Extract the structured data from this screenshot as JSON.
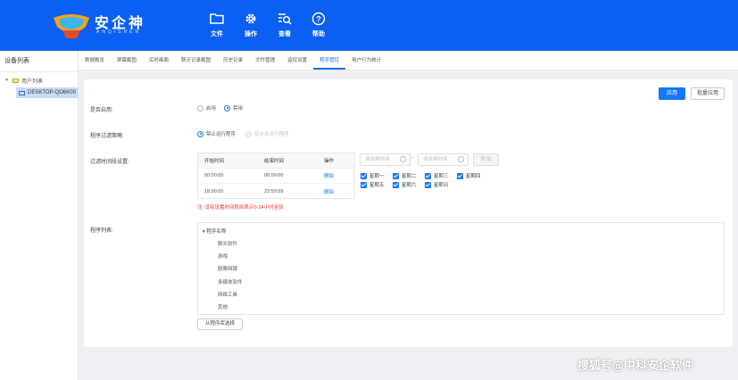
{
  "app": {
    "brand": "安企神",
    "brand_sub": "ANQISHEN"
  },
  "topnav": [
    {
      "icon": "folder-icon",
      "label": "文件"
    },
    {
      "icon": "gear-icon",
      "label": "操作"
    },
    {
      "icon": "search-list-icon",
      "label": "查看"
    },
    {
      "icon": "help-icon",
      "label": "帮助"
    }
  ],
  "sidebar": {
    "title": "设备列表",
    "root": "用户列表",
    "device": "DESKTOP-QO6K00"
  },
  "tabs": [
    "数据概览",
    "屏幕截图",
    "实时画面",
    "聊天记录截图",
    "历史记录",
    "文件管理",
    "监控设置",
    "程序管控",
    "用户行为统计"
  ],
  "active_tab": "程序管控",
  "actions": {
    "apply": "应用",
    "batch_apply": "批量应用"
  },
  "enable": {
    "label": "是否启用:",
    "options": [
      "启用",
      "禁用"
    ],
    "selected": "禁用"
  },
  "strategy": {
    "label": "程序过滤策略:",
    "options": [
      "禁止运行程序",
      "仅允许运行程序"
    ],
    "selected": "禁止运行程序"
  },
  "period": {
    "label": "过滤时间段设置:",
    "columns": [
      "开始时间",
      "结束时间",
      "操作"
    ],
    "rows": [
      {
        "start": "00:00:00",
        "end": "08:00:00",
        "action": "删除"
      },
      {
        "start": "18:00:00",
        "end": "23:59:59",
        "action": "删除"
      }
    ],
    "note": "注: 没有设置时间段则表示0-24小时全段",
    "start_placeholder": "请选择时间",
    "end_placeholder": "请选择时间",
    "add_label": "添 加",
    "weekdays": [
      "星期一",
      "星期二",
      "星期三",
      "星期四",
      "星期五",
      "星期六",
      "星期日"
    ]
  },
  "programs": {
    "label": "程序列表:",
    "root": "程序名称",
    "items": [
      "聊天软件",
      "游戏",
      "股票网银",
      "多媒体软件",
      "网络工具",
      "其他"
    ],
    "library_button": "从程序库选择"
  },
  "watermark": "搜狐号@中科安企软件",
  "colors": {
    "primary": "#1677ff",
    "topbar": "#0b5ff2",
    "note": "#e33333"
  }
}
